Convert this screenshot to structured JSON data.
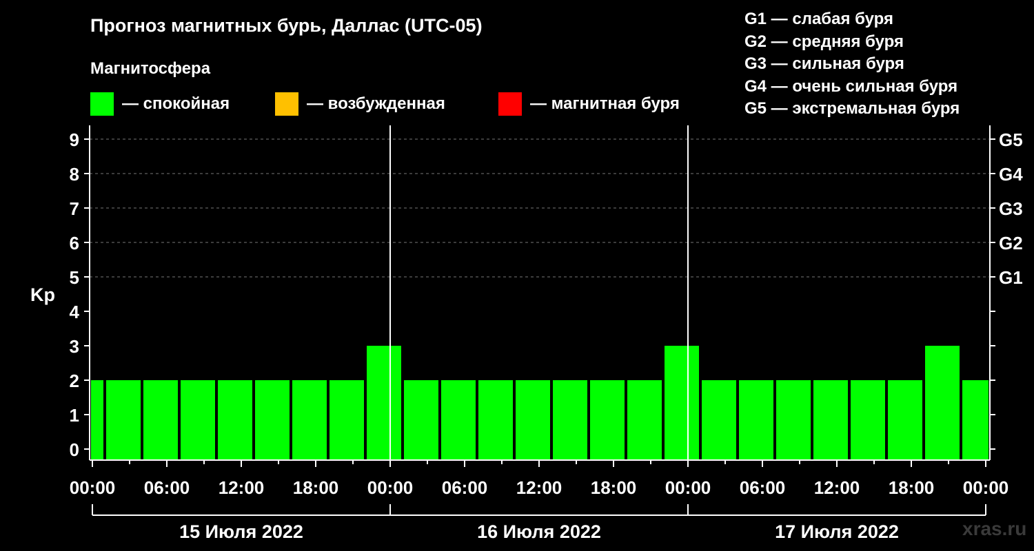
{
  "header": {
    "title": "Прогноз магнитных бурь, Даллас (UTC-05)",
    "subtitle": "Магнитосфера"
  },
  "legend": {
    "items": [
      {
        "label": "— спокойная",
        "color": "#00ff00"
      },
      {
        "label": "— возбужденная",
        "color": "#ffc000"
      },
      {
        "label": "— магнитная буря",
        "color": "#ff0000"
      }
    ]
  },
  "g_legend": [
    "G1 — слабая буря",
    "G2 — средняя буря",
    "G3 — сильная буря",
    "G4 — очень сильная буря",
    "G5 — экстремальная буря"
  ],
  "watermark": "xras.ru",
  "chart_data": {
    "type": "bar",
    "ylabel": "Kp",
    "ylim": [
      0,
      9
    ],
    "yticks": [
      "0",
      "1",
      "2",
      "3",
      "4",
      "5",
      "6",
      "7",
      "8",
      "9"
    ],
    "right_ticks": [
      {
        "kp": 5,
        "label": "G1"
      },
      {
        "kp": 6,
        "label": "G2"
      },
      {
        "kp": 7,
        "label": "G3"
      },
      {
        "kp": 8,
        "label": "G4"
      },
      {
        "kp": 9,
        "label": "G5"
      }
    ],
    "x_hours_range": [
      0,
      72
    ],
    "xtick_labels": [
      "00:00",
      "06:00",
      "12:00",
      "18:00",
      "00:00",
      "06:00",
      "12:00",
      "18:00",
      "00:00",
      "06:00",
      "12:00",
      "18:00",
      "00:00"
    ],
    "days": [
      "15 Июля 2022",
      "16 Июля 2022",
      "17 Июля 2022"
    ],
    "bar_interval_hours": 3,
    "first_bar_start_hour": -2,
    "values": [
      2,
      2,
      2,
      2,
      2,
      2,
      2,
      2,
      3,
      2,
      2,
      2,
      2,
      2,
      2,
      2,
      3,
      2,
      2,
      2,
      2,
      2,
      2,
      3,
      2
    ],
    "grid": true,
    "colors": {
      "calm": "#00ff00",
      "active": "#ffc000",
      "storm": "#ff0000"
    }
  }
}
